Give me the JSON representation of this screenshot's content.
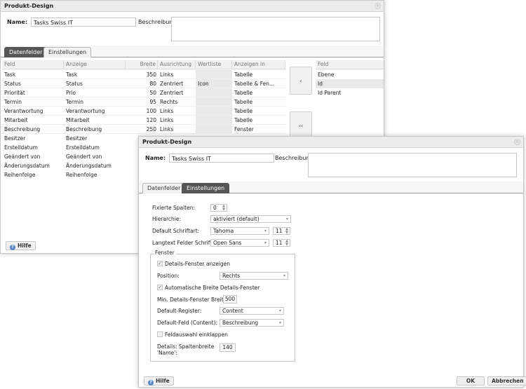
{
  "back_dialog": {
    "title": "Produkt-Design",
    "name_label": "Name:",
    "name_value": "Tasks Swiss IT",
    "beschreibung_label": "Beschreibung:",
    "tabs": [
      "Datenfelder",
      "Einstellungen"
    ],
    "columns": [
      "Feld",
      "Anzeige",
      "Breite",
      "Ausrichtung",
      "Wertliste",
      "Anzeigen in"
    ],
    "rows": [
      {
        "feld": "Task",
        "anzeige": "Task",
        "breite": "350",
        "ausrichtung": "Links",
        "wertliste": "",
        "anzeigen_in": "Tabelle"
      },
      {
        "feld": "Status",
        "anzeige": "Status",
        "breite": "80",
        "ausrichtung": "Zentriert",
        "wertliste": "Icon",
        "anzeigen_in": "Tabelle & Fen..."
      },
      {
        "feld": "Priorität",
        "anzeige": "Prio",
        "breite": "50",
        "ausrichtung": "Zentriert",
        "wertliste": "",
        "anzeigen_in": "Tabelle"
      },
      {
        "feld": "Termin",
        "anzeige": "Termin",
        "breite": "95",
        "ausrichtung": "Rechts",
        "wertliste": "",
        "anzeigen_in": "Tabelle"
      },
      {
        "feld": "Verantwortung",
        "anzeige": "Verantwortung",
        "breite": "100",
        "ausrichtung": "Links",
        "wertliste": "",
        "anzeigen_in": "Tabelle"
      },
      {
        "feld": "Mitarbeit",
        "anzeige": "Mitarbeit",
        "breite": "120",
        "ausrichtung": "Links",
        "wertliste": "",
        "anzeigen_in": "Tabelle"
      },
      {
        "feld": "Beschreibung",
        "anzeige": "Beschreibung",
        "breite": "250",
        "ausrichtung": "Links",
        "wertliste": "",
        "anzeigen_in": "Fenster"
      },
      {
        "feld": "Besitzer",
        "anzeige": "Besitzer",
        "breite": "",
        "ausrichtung": "",
        "wertliste": "",
        "anzeigen_in": ""
      },
      {
        "feld": "Erstelldatum",
        "anzeige": "Erstelldatum",
        "breite": "",
        "ausrichtung": "",
        "wertliste": "",
        "anzeigen_in": ""
      },
      {
        "feld": "Geändert von",
        "anzeige": "Geändert von",
        "breite": "",
        "ausrichtung": "",
        "wertliste": "",
        "anzeigen_in": ""
      },
      {
        "feld": "Änderungsdatum",
        "anzeige": "Änderungsdatum",
        "breite": "",
        "ausrichtung": "",
        "wertliste": "",
        "anzeigen_in": ""
      },
      {
        "feld": "Reihenfolge",
        "anzeige": "Reihenfolge",
        "breite": "",
        "ausrichtung": "",
        "wertliste": "",
        "anzeigen_in": ""
      }
    ],
    "move_right_label": "‹",
    "move_all_label": "‹‹",
    "right_column_header": "Feld",
    "right_rows": [
      "Ebene",
      "Id",
      "Id Parent"
    ],
    "help_label": "Hilfe"
  },
  "front_dialog": {
    "title": "Produkt-Design",
    "name_label": "Name:",
    "name_value": "Tasks Swiss IT",
    "beschreibung_label": "Beschreibung:",
    "tabs": [
      "Datenfelder",
      "Einstellungen"
    ],
    "settings": {
      "fixierte_spalten_label": "Fixierte Spalten:",
      "fixierte_spalten_value": "0",
      "hierarchie_label": "Hierarchie:",
      "hierarchie_value": "aktiviert (default)",
      "default_schriftart_label": "Default Schriftart:",
      "default_schriftart_value": "Tahoma",
      "default_schriftgroesse": "11",
      "langtext_label": "Langtext Felder Schriftart:",
      "langtext_value": "Open Sans",
      "langtext_groesse": "11"
    },
    "fenster": {
      "legend": "Fenster",
      "details_fenster_label": "Details-Fenster anzeigen",
      "details_fenster_checked": true,
      "position_label": "Position:",
      "position_value": "Rechts",
      "auto_breite_label": "Automatische Breite Details-Fenster",
      "auto_breite_checked": true,
      "min_breite_label": "Min. Details-Fenster Breite:",
      "min_breite_value": "500",
      "default_register_label": "Default-Register:",
      "default_register_value": "Content",
      "default_feld_label": "Default-Feld (Content):",
      "default_feld_value": "Beschreibung",
      "feldauswahl_label": "Feldauswahl einklappen",
      "feldauswahl_checked": false,
      "spaltenbreite_label_1": "Details: Spaltenbreite",
      "spaltenbreite_label_2": "'Name':",
      "spaltenbreite_value": "140"
    },
    "help_label": "Hilfe",
    "ok_label": "OK",
    "cancel_label": "Abbrechen"
  },
  "icons": {
    "close": "close-icon",
    "help": "help-icon",
    "check": "✓",
    "caret": "▾",
    "spin_up": "▲",
    "spin_down": "▼"
  }
}
